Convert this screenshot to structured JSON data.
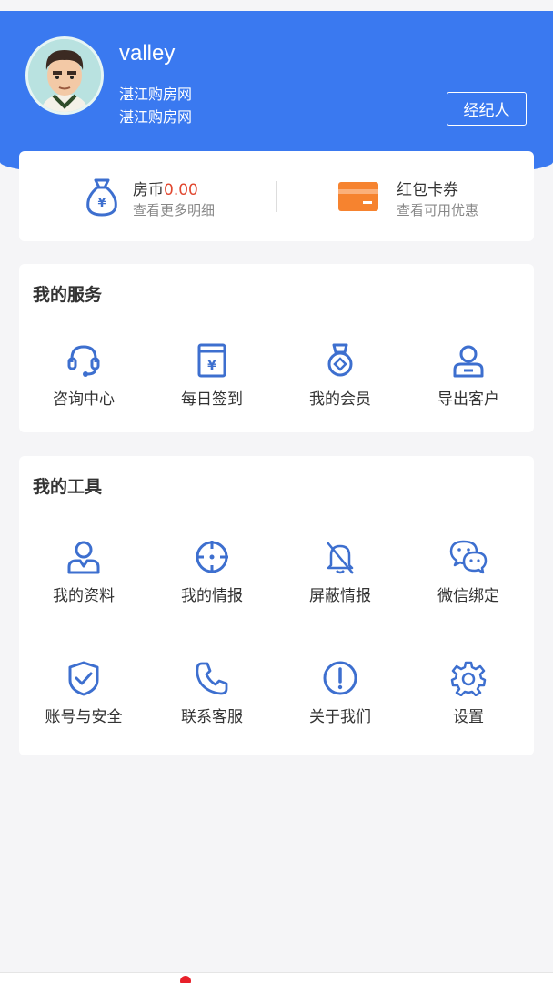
{
  "profile": {
    "name": "valley",
    "org_line1": "湛江购房网",
    "org_line2": "湛江购房网",
    "role_button": "经纪人"
  },
  "wallet": {
    "coins_label": "房币",
    "coins_value": "0.00",
    "coins_sub": "查看更多明细",
    "coupon_label": "红包卡券",
    "coupon_sub": "查看可用优惠"
  },
  "services": {
    "title": "我的服务",
    "items": [
      {
        "label": "咨询中心",
        "icon": "headset-icon"
      },
      {
        "label": "每日签到",
        "icon": "calendar-yen-icon"
      },
      {
        "label": "我的会员",
        "icon": "medal-icon"
      },
      {
        "label": "导出客户",
        "icon": "user-export-icon"
      }
    ]
  },
  "tools": {
    "title": "我的工具",
    "items": [
      {
        "label": "我的资料",
        "icon": "user-icon"
      },
      {
        "label": "我的情报",
        "icon": "crosshair-icon"
      },
      {
        "label": "屏蔽情报",
        "icon": "bell-off-icon"
      },
      {
        "label": "微信绑定",
        "icon": "wechat-icon"
      },
      {
        "label": "账号与安全",
        "icon": "shield-check-icon"
      },
      {
        "label": "联系客服",
        "icon": "phone-icon"
      },
      {
        "label": "关于我们",
        "icon": "info-icon"
      },
      {
        "label": "设置",
        "icon": "gear-icon"
      }
    ]
  },
  "colors": {
    "primary": "#3a79f0",
    "icon": "#3d6fcf",
    "coin_value": "#e1472f",
    "coupon": "#f6832f"
  }
}
